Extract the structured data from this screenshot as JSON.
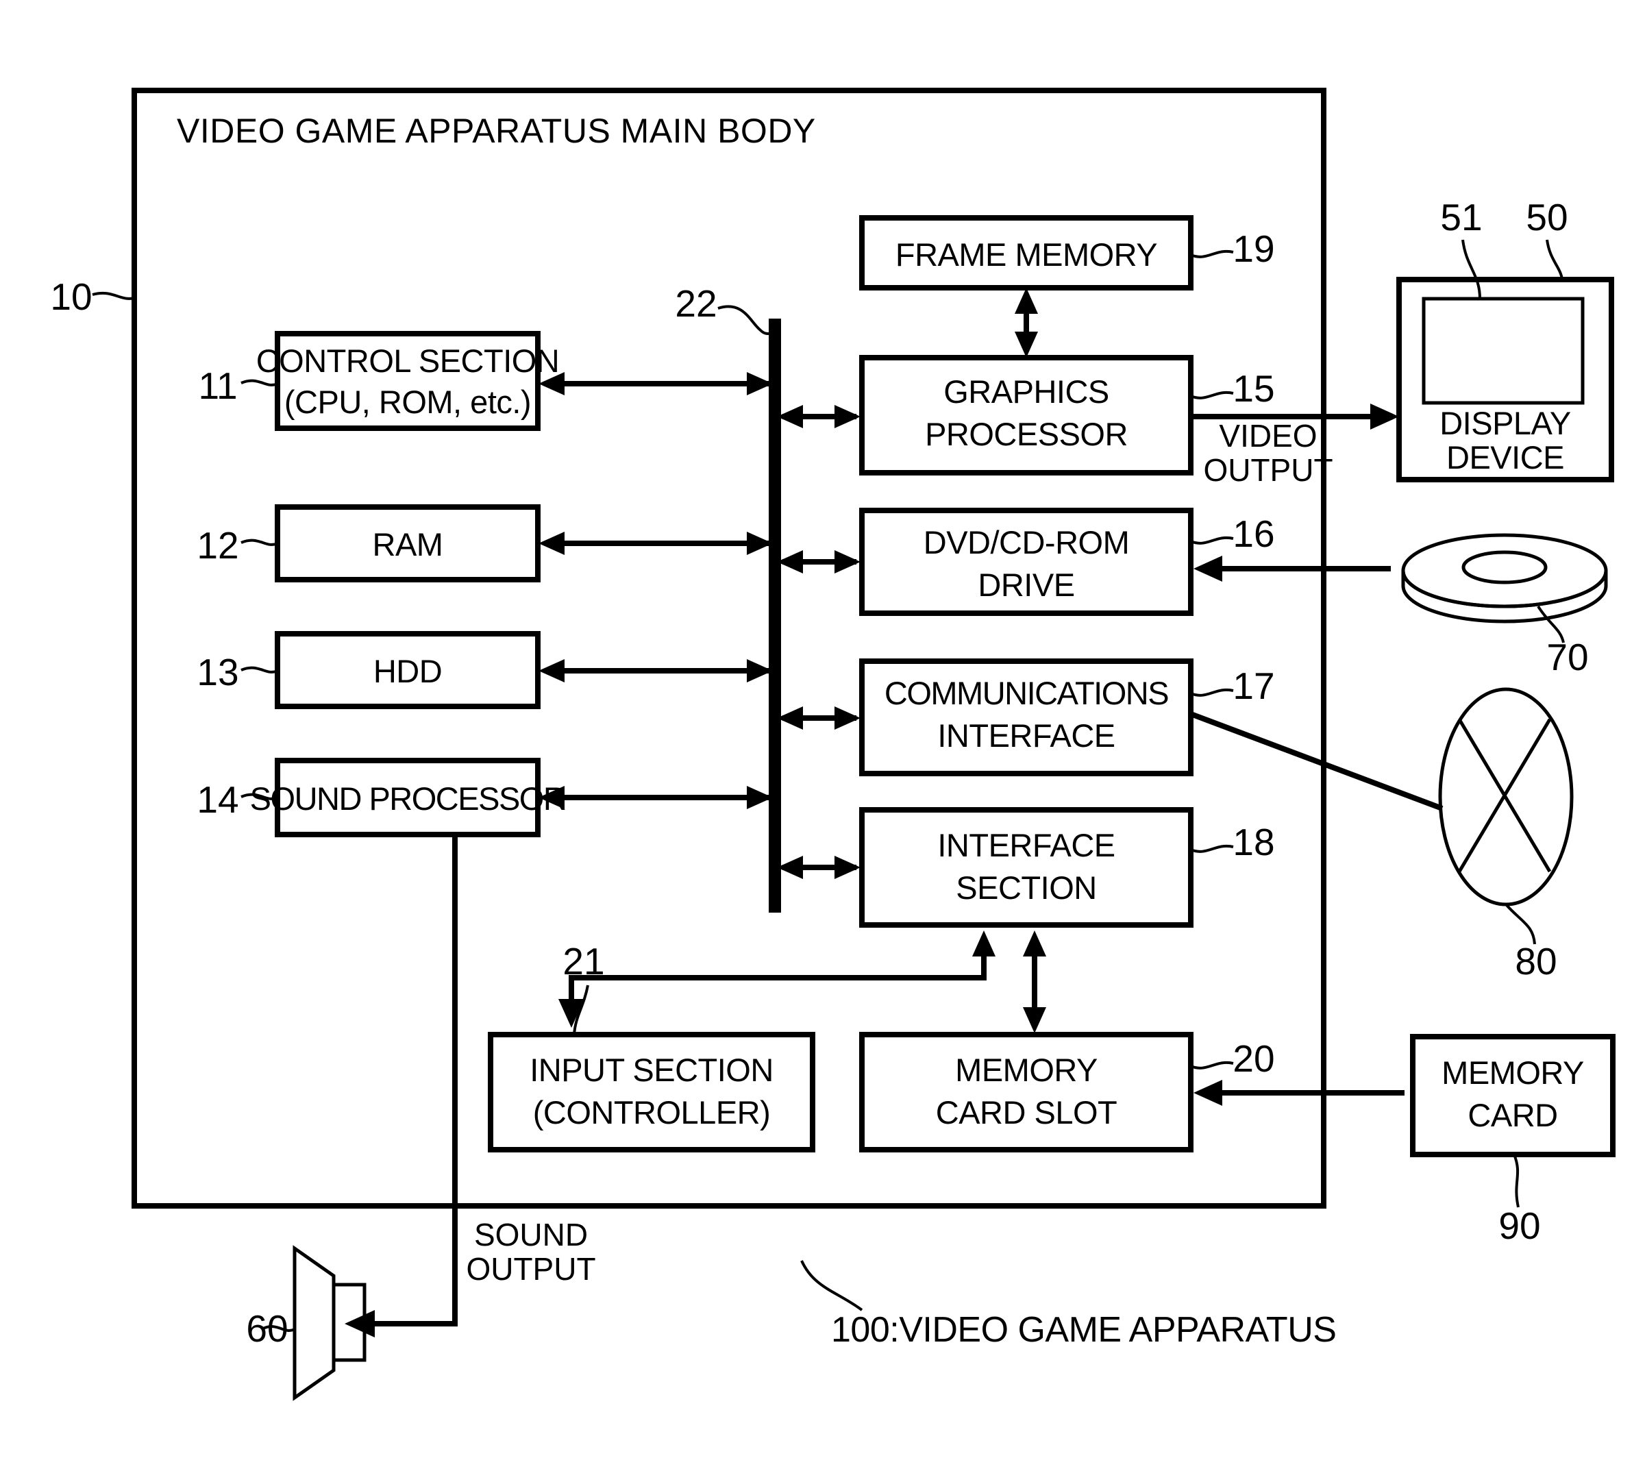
{
  "figure": {
    "title": "VIDEO GAME APPARATUS MAIN BODY",
    "caption": "100:VIDEO GAME APPARATUS"
  },
  "blocks": {
    "control_section": {
      "line1": "CONTROL SECTION",
      "line2": "(CPU, ROM, etc.)",
      "ref": "11"
    },
    "ram": {
      "line1": "RAM",
      "ref": "12"
    },
    "hdd": {
      "line1": "HDD",
      "ref": "13"
    },
    "sound_processor": {
      "line1": "SOUND PROCESSOR",
      "ref": "14"
    },
    "frame_memory": {
      "line1": "FRAME MEMORY",
      "ref": "19"
    },
    "graphics_processor": {
      "line1": "GRAPHICS",
      "line2": "PROCESSOR",
      "ref": "15"
    },
    "dvd_cd_rom_drive": {
      "line1": "DVD/CD-ROM",
      "line2": "DRIVE",
      "ref": "16"
    },
    "communications_interface": {
      "line1": "COMMUNICATIONS",
      "line2": "INTERFACE",
      "ref": "17"
    },
    "interface_section": {
      "line1": "INTERFACE",
      "line2": "SECTION",
      "ref": "18"
    },
    "input_section": {
      "line1": "INPUT SECTION",
      "line2": "(CONTROLLER)",
      "ref": "21"
    },
    "memory_card_slot": {
      "line1": "MEMORY",
      "line2": "CARD SLOT",
      "ref": "20"
    },
    "display_device": {
      "line1": "DISPLAY",
      "line2": "DEVICE",
      "ref": "50",
      "screen_ref": "51"
    },
    "memory_card": {
      "line1": "MEMORY",
      "line2": "CARD",
      "ref": "90"
    },
    "optical_disc": {
      "ref": "70"
    },
    "network": {
      "ref": "80"
    },
    "speaker": {
      "ref": "60"
    },
    "main_body": {
      "ref": "10"
    },
    "bus": {
      "ref": "22"
    }
  },
  "connector_labels": {
    "video_output": {
      "line1": "VIDEO",
      "line2": "OUTPUT"
    },
    "sound_output": {
      "line1": "SOUND",
      "line2": "OUTPUT"
    }
  }
}
